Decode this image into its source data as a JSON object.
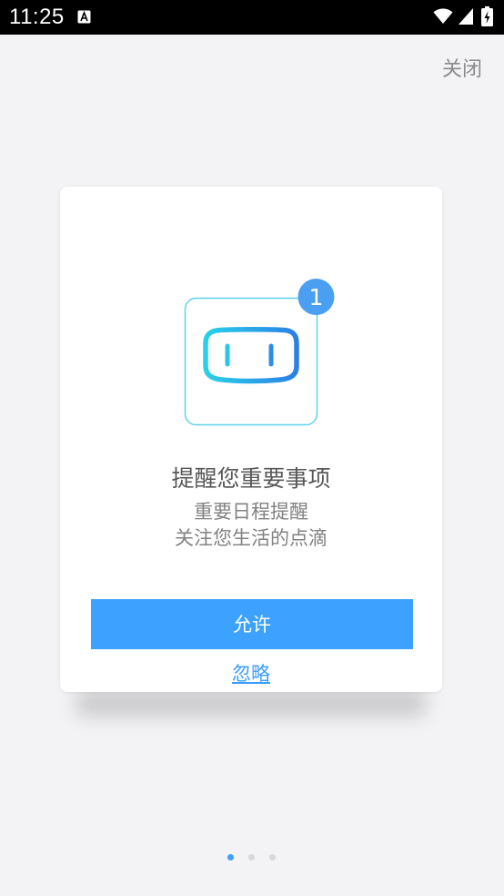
{
  "status_bar": {
    "time": "11:25",
    "icons": [
      "a-notification-icon",
      "wifi-icon",
      "signal-icon",
      "battery-icon"
    ]
  },
  "header": {
    "close_label": "关闭"
  },
  "dialog": {
    "badge_count": "1",
    "illustration_icon": "plug-face-icon",
    "title": "提醒您重要事项",
    "subtitle_line1": "重要日程提醒",
    "subtitle_line2": "关注您生活的点滴",
    "allow_label": "允许",
    "ignore_label": "忽略"
  },
  "pager": {
    "page_count": 3,
    "active_index": 0
  },
  "colors": {
    "accent": "#3ca1ff",
    "background": "#f3f3f5",
    "illustration_gradient": [
      "#29d1e8",
      "#2b7fe5"
    ]
  }
}
